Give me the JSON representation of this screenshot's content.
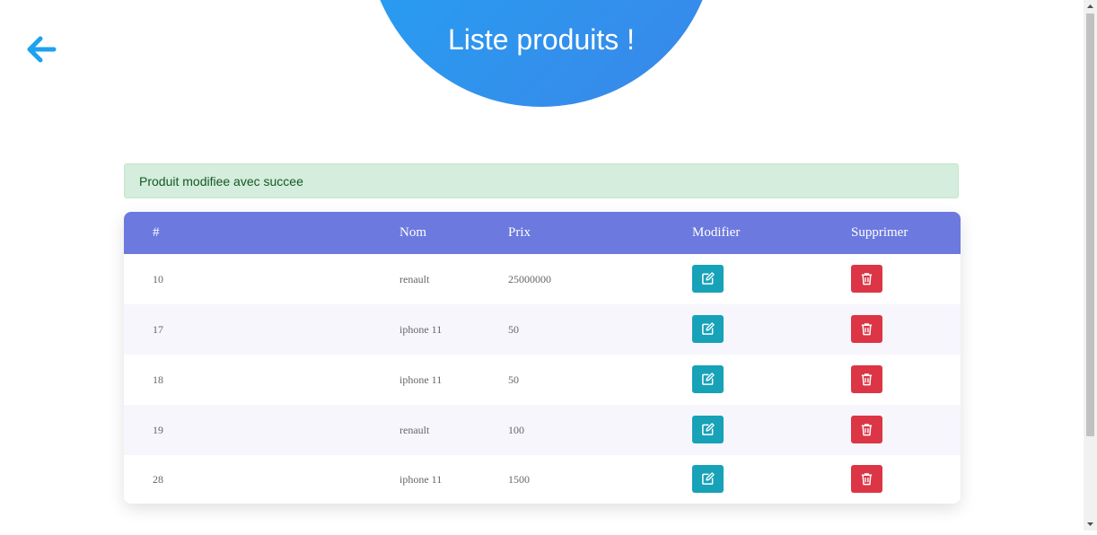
{
  "page": {
    "title": "Liste produits !",
    "alert": "Produit modifiee avec succee"
  },
  "icons": {
    "back": "arrow-left-icon",
    "edit": "edit-icon",
    "delete": "trash-icon"
  },
  "colors": {
    "hero_gradient_start": "#1ea8f5",
    "hero_gradient_end": "#3b86e8",
    "back_arrow": "#1ea2ee",
    "table_header": "#6c79de",
    "alert_bg": "#d4eddc",
    "alert_text": "#155724",
    "edit_button": "#17a2b8",
    "delete_button": "#dc3545"
  },
  "table": {
    "headers": {
      "id": "#",
      "name": "Nom",
      "price": "Prix",
      "edit": "Modifier",
      "delete": "Supprimer"
    },
    "rows": [
      {
        "id": "10",
        "name": "renault",
        "price": "25000000"
      },
      {
        "id": "17",
        "name": "iphone 11",
        "price": "50"
      },
      {
        "id": "18",
        "name": "iphone 11",
        "price": "50"
      },
      {
        "id": "19",
        "name": "renault",
        "price": "100"
      },
      {
        "id": "28",
        "name": "iphone 11",
        "price": "1500"
      }
    ]
  }
}
